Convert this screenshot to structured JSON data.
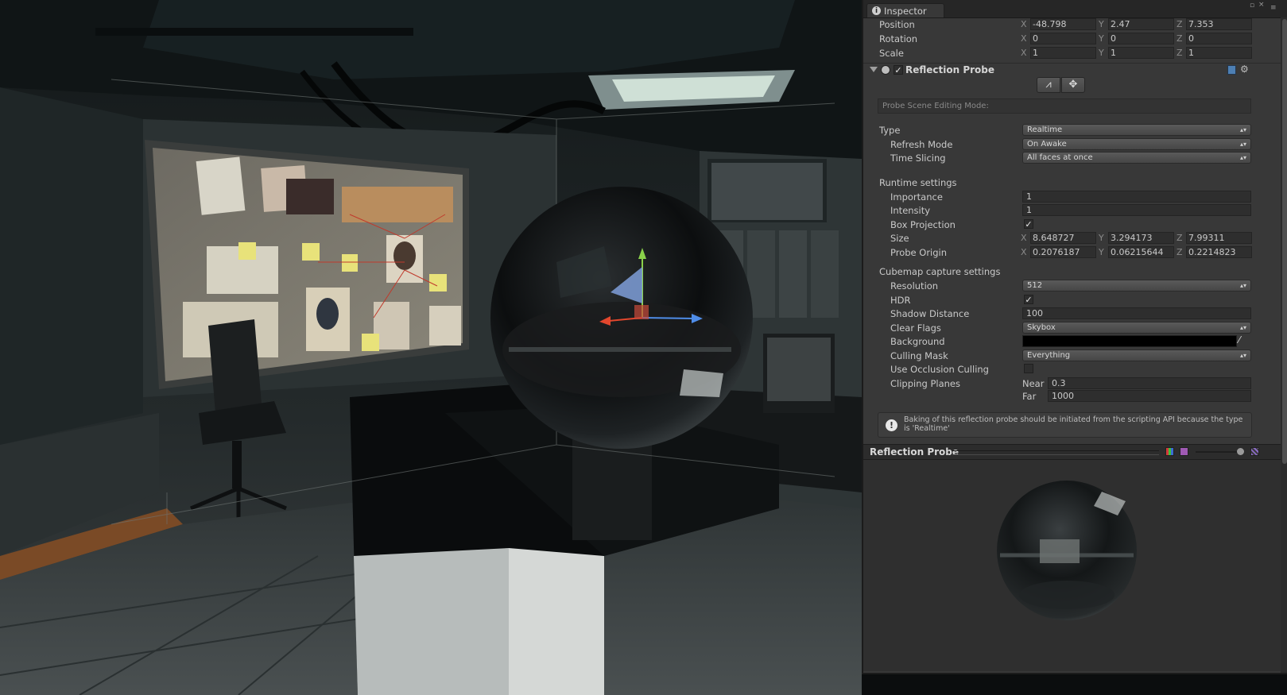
{
  "inspector": {
    "tab_title": "Inspector",
    "transform": [
      {
        "label": "Position",
        "x": "-48.798",
        "y": "2.47",
        "z": "7.353"
      },
      {
        "label": "Rotation",
        "x": "0",
        "y": "0",
        "z": "0"
      },
      {
        "label": "Scale",
        "x": "1",
        "y": "1",
        "z": "1"
      }
    ],
    "component": {
      "title": "Reflection Probe",
      "enabled": true
    },
    "edit_mode_label": "Probe Scene Editing Mode:",
    "type": {
      "label": "Type",
      "value": "Realtime"
    },
    "refresh_mode": {
      "label": "Refresh Mode",
      "value": "On Awake"
    },
    "time_slicing": {
      "label": "Time Slicing",
      "value": "All faces at once"
    },
    "runtime_settings": "Runtime settings",
    "importance": {
      "label": "Importance",
      "value": "1"
    },
    "intensity": {
      "label": "Intensity",
      "value": "1"
    },
    "box_projection": {
      "label": "Box Projection",
      "checked": true
    },
    "size": {
      "label": "Size",
      "x": "8.648727",
      "y": "3.294173",
      "z": "7.99311"
    },
    "probe_origin": {
      "label": "Probe Origin",
      "x": "0.2076187",
      "y": "0.06215644",
      "z": "0.2214823"
    },
    "cubemap_settings": "Cubemap capture settings",
    "resolution": {
      "label": "Resolution",
      "value": "512"
    },
    "hdr": {
      "label": "HDR",
      "checked": true
    },
    "shadow_distance": {
      "label": "Shadow Distance",
      "value": "100"
    },
    "clear_flags": {
      "label": "Clear Flags",
      "value": "Skybox"
    },
    "background": {
      "label": "Background",
      "color": "#000000"
    },
    "culling_mask": {
      "label": "Culling Mask",
      "value": "Everything"
    },
    "occlusion_culling": {
      "label": "Use Occlusion Culling",
      "checked": false
    },
    "clipping_planes": {
      "label": "Clipping Planes",
      "near_label": "Near",
      "near": "0.3",
      "far_label": "Far",
      "far": "1000"
    },
    "help_text": "Baking of this reflection probe should be initiated from the scripting API because the type is 'Realtime'",
    "preview_title": "Reflection Probe",
    "axis": {
      "x": "X",
      "y": "Y",
      "z": "Z"
    }
  },
  "icons": [
    "info-icon",
    "probe-component-icon",
    "book-icon",
    "gear-icon",
    "edit-bounds-icon",
    "edit-origin-icon",
    "warning-icon",
    "color-picker-icon"
  ],
  "colors": {
    "panel": "#383838",
    "field": "#2e2e2e",
    "gizmo_y": "#8ad14a",
    "gizmo_x": "#e2472d",
    "gizmo_z": "#4f8de8"
  }
}
